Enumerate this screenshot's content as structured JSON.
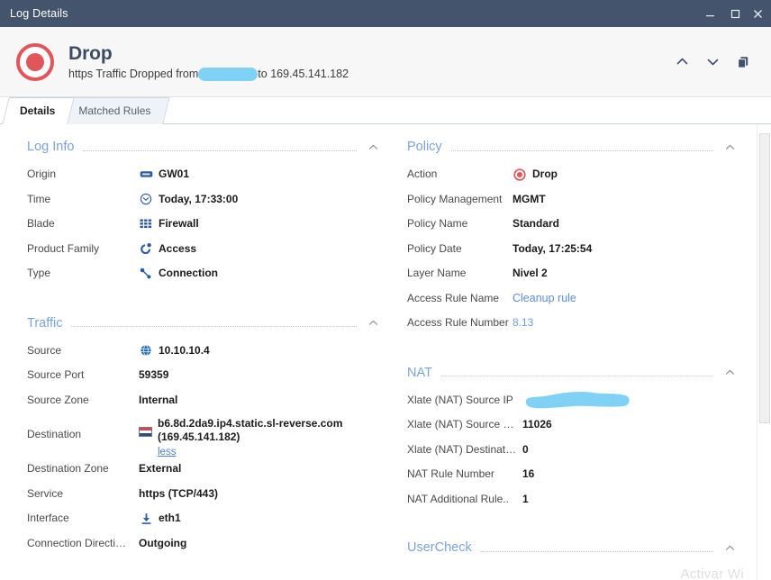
{
  "window": {
    "title": "Log Details",
    "controls": {
      "minimize": "minimize-icon",
      "maximize": "maximize-icon",
      "close": "close-icon"
    }
  },
  "header": {
    "icon": "drop-action-icon",
    "title": "Drop",
    "subtitle_prefix": "https Traffic Dropped from",
    "subtitle_redacted": "",
    "subtitle_middle": "to ",
    "subtitle_destination": "169.45.141.182",
    "actions": {
      "previous": "chevron-up-icon",
      "next": "chevron-down-icon",
      "copy": "copy-icon"
    }
  },
  "tabs": [
    {
      "label": "Details",
      "active": true
    },
    {
      "label": "Matched Rules",
      "active": false
    }
  ],
  "sections": {
    "log_info": {
      "title": "Log Info",
      "rows": [
        {
          "key": "Origin",
          "value": "GW01",
          "icon": "gateway-icon"
        },
        {
          "key": "Time",
          "value": "Today, 17:33:00",
          "icon": "clock-icon"
        },
        {
          "key": "Blade",
          "value": "Firewall",
          "icon": "firewall-grid-icon"
        },
        {
          "key": "Product Family",
          "value": "Access",
          "icon": "access-icon"
        },
        {
          "key": "Type",
          "value": "Connection",
          "icon": "connection-icon"
        }
      ]
    },
    "traffic": {
      "title": "Traffic",
      "rows": [
        {
          "key": "Source",
          "value": "10.10.10.4",
          "icon": "globe-icon"
        },
        {
          "key": "Source Port",
          "value": "59359",
          "icon": ""
        },
        {
          "key": "Source Zone",
          "value": "Internal",
          "icon": ""
        }
      ],
      "destination": {
        "key": "Destination",
        "icon": "netherlands-flag-icon",
        "hostname": "b6.8d.2da9.ip4.static.sl-reverse.com",
        "ip": "(169.45.141.182)",
        "toggle": "less"
      },
      "rows_after": [
        {
          "key": "Destination Zone",
          "value": "External",
          "icon": ""
        },
        {
          "key": "Service",
          "value": "https (TCP/443)",
          "icon": ""
        },
        {
          "key": "Interface",
          "value": "eth1",
          "icon": "interface-inbound-icon"
        },
        {
          "key": "Connection Directi…",
          "value": "Outgoing",
          "icon": ""
        }
      ]
    },
    "policy": {
      "title": "Policy",
      "rows": [
        {
          "key": "Action",
          "value": "Drop",
          "icon": "drop-action-icon",
          "style": ""
        },
        {
          "key": "Policy Management",
          "value": "MGMT",
          "icon": "",
          "style": ""
        },
        {
          "key": "Policy Name",
          "value": "Standard",
          "icon": "",
          "style": ""
        },
        {
          "key": "Policy Date",
          "value": "Today, 17:25:54",
          "icon": "",
          "style": ""
        },
        {
          "key": "Layer Name",
          "value": "Nivel 2",
          "icon": "",
          "style": ""
        },
        {
          "key": "Access Rule Name",
          "value": "Cleanup rule",
          "icon": "",
          "style": "link"
        },
        {
          "key": "Access Rule Number",
          "value": "8.13",
          "icon": "",
          "style": "linksm"
        }
      ]
    },
    "nat": {
      "title": "NAT",
      "redacted_row": {
        "key": "Xlate (NAT) Source IP",
        "value": ""
      },
      "rows": [
        {
          "key": "Xlate (NAT) Source …",
          "value": "11026"
        },
        {
          "key": "Xlate (NAT) Destinat…",
          "value": "0"
        },
        {
          "key": "NAT Rule Number",
          "value": "16"
        },
        {
          "key": "NAT Additional Rule..",
          "value": "1"
        }
      ]
    },
    "usercheck": {
      "title": "UserCheck"
    }
  },
  "watermark": "Activar Wi",
  "colors": {
    "titlebar": "#44546d",
    "accent_red": "#e2565b",
    "section_blue": "#7ba3d9",
    "link_blue": "#5b8fd6",
    "redaction": "#7fd1f5"
  }
}
